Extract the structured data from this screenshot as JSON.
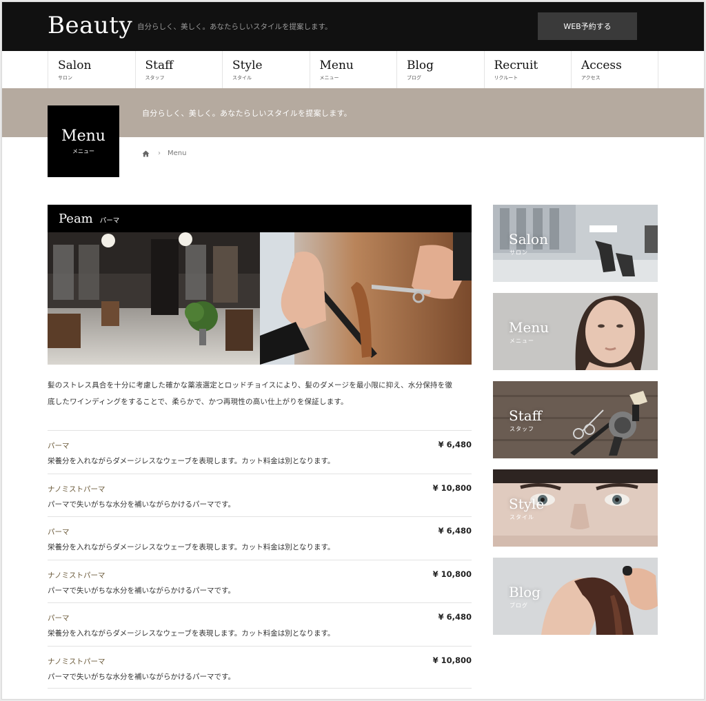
{
  "header": {
    "logo": "Beauty",
    "tagline": "自分らしく、美しく。あなたらしいスタイルを提案します。",
    "reserve_label": "WEB予約する"
  },
  "nav": [
    {
      "en": "Salon",
      "jp": "サロン"
    },
    {
      "en": "Staff",
      "jp": "スタッフ"
    },
    {
      "en": "Style",
      "jp": "スタイル"
    },
    {
      "en": "Menu",
      "jp": "メニュー"
    },
    {
      "en": "Blog",
      "jp": "ブログ"
    },
    {
      "en": "Recruit",
      "jp": "リクルート"
    },
    {
      "en": "Access",
      "jp": "アクセス"
    }
  ],
  "banner": {
    "text": "自分らしく、美しく。あなたらしいスタイルを提案します。"
  },
  "page_title": {
    "en": "Menu",
    "jp": "メニュー"
  },
  "breadcrumb": {
    "home_icon": "home-icon",
    "current": "Menu"
  },
  "section": {
    "en": "Peam",
    "jp": "パーマ",
    "description_line1": "髪のストレス具合を十分に考慮した確かな薬液選定とロッドチョイスにより、髪のダメージを最小限に抑え、水分保持を徹",
    "description_line2": "底したワインディングをすることで、柔らかで、かつ再現性の高い仕上がりを保証します。"
  },
  "menu_items": [
    {
      "name": "パーマ",
      "price": "¥ 6,480",
      "note": "栄養分を入れながらダメージレスなウェーブを表現します。カット料金は別となります。"
    },
    {
      "name": "ナノミストパーマ",
      "price": "¥ 10,800",
      "note": "パーマで失いがちな水分を補いながらかけるパーマです。"
    },
    {
      "name": "パーマ",
      "price": "¥ 6,480",
      "note": "栄養分を入れながらダメージレスなウェーブを表現します。カット料金は別となります。"
    },
    {
      "name": "ナノミストパーマ",
      "price": "¥ 10,800",
      "note": "パーマで失いがちな水分を補いながらかけるパーマです。"
    },
    {
      "name": "パーマ",
      "price": "¥ 6,480",
      "note": "栄養分を入れながらダメージレスなウェーブを表現します。カット料金は別となります。"
    },
    {
      "name": "ナノミストパーマ",
      "price": "¥ 10,800",
      "note": "パーマで失いがちな水分を補いながらかけるパーマです。"
    }
  ],
  "sidebar": [
    {
      "en": "Salon",
      "jp": "サロン"
    },
    {
      "en": "Menu",
      "jp": "メニュー"
    },
    {
      "en": "Staff",
      "jp": "スタッフ"
    },
    {
      "en": "Style",
      "jp": "スタイル"
    },
    {
      "en": "Blog",
      "jp": "ブログ"
    }
  ],
  "colors": {
    "header_bg": "#111111",
    "banner_bg": "#b5aa9f",
    "menu_name": "#6b5a3a"
  }
}
